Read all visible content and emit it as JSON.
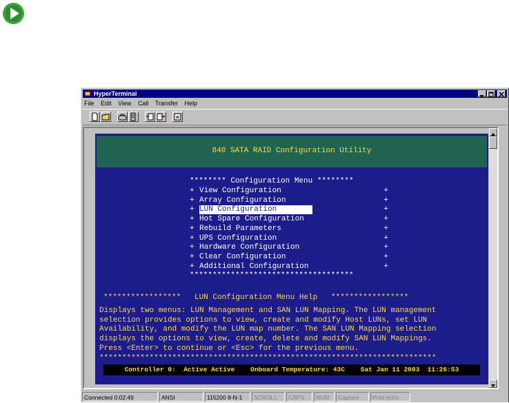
{
  "window": {
    "title": "HyperTerminal"
  },
  "menubar": [
    "File",
    "Edit",
    "View",
    "Call",
    "Transfer",
    "Help"
  ],
  "toolbar": {
    "buttons": [
      "new-icon",
      "open-icon",
      "connect-icon",
      "disconnect-icon",
      "send-icon",
      "receive-icon",
      "properties-icon"
    ]
  },
  "terminal": {
    "header": "840 SATA RAID Configuration Utility",
    "menu_border_top": "******** Configuration Menu ********",
    "menu_border_bottom": "************************************",
    "menu_items": [
      "View Configuration",
      "Array Configuration",
      "LUN Configuration",
      "Hot Spare Configuration",
      "Rebuild Parameters",
      "UPS Configuration",
      "Hardware Configuration",
      "Clear Configuration",
      "Additional Configuration"
    ],
    "selected_index": 2,
    "help_title": "*****************   LUN Configuration Menu Help   *****************",
    "help_lines": [
      "Displays two menus: LUN Management and SAN LUN Mapping. The LUN management",
      "selection provides options to view, create and modify Host LUNs, set LUN",
      "Availability, and modify the LUN map number. The SAN LUN Mapping selection",
      "displays the options to view, create, delete and modify SAN LUN Mappings.",
      "Press <Enter> to continue or <Esc> for the previous menu.",
      "**************************************************************************"
    ],
    "status": "Controller 0:  Active Active    Onboard Temperature: 43C    Sat Jan 11 2003  11:26:53"
  },
  "statusbar": {
    "connected": "Connected 0:02:49",
    "emulation": "ANSI",
    "port_settings": "115200 8-N-1",
    "scroll": "SCROLL",
    "caps": "CAPS",
    "num": "NUM",
    "capture": "Capture",
    "print_echo": "Print echo"
  },
  "colors": {
    "terminal_bg": "#1c1c8c",
    "header_bg": "#1e6450",
    "highlight_text": "#ffd84a",
    "titlebar": "#000080"
  }
}
